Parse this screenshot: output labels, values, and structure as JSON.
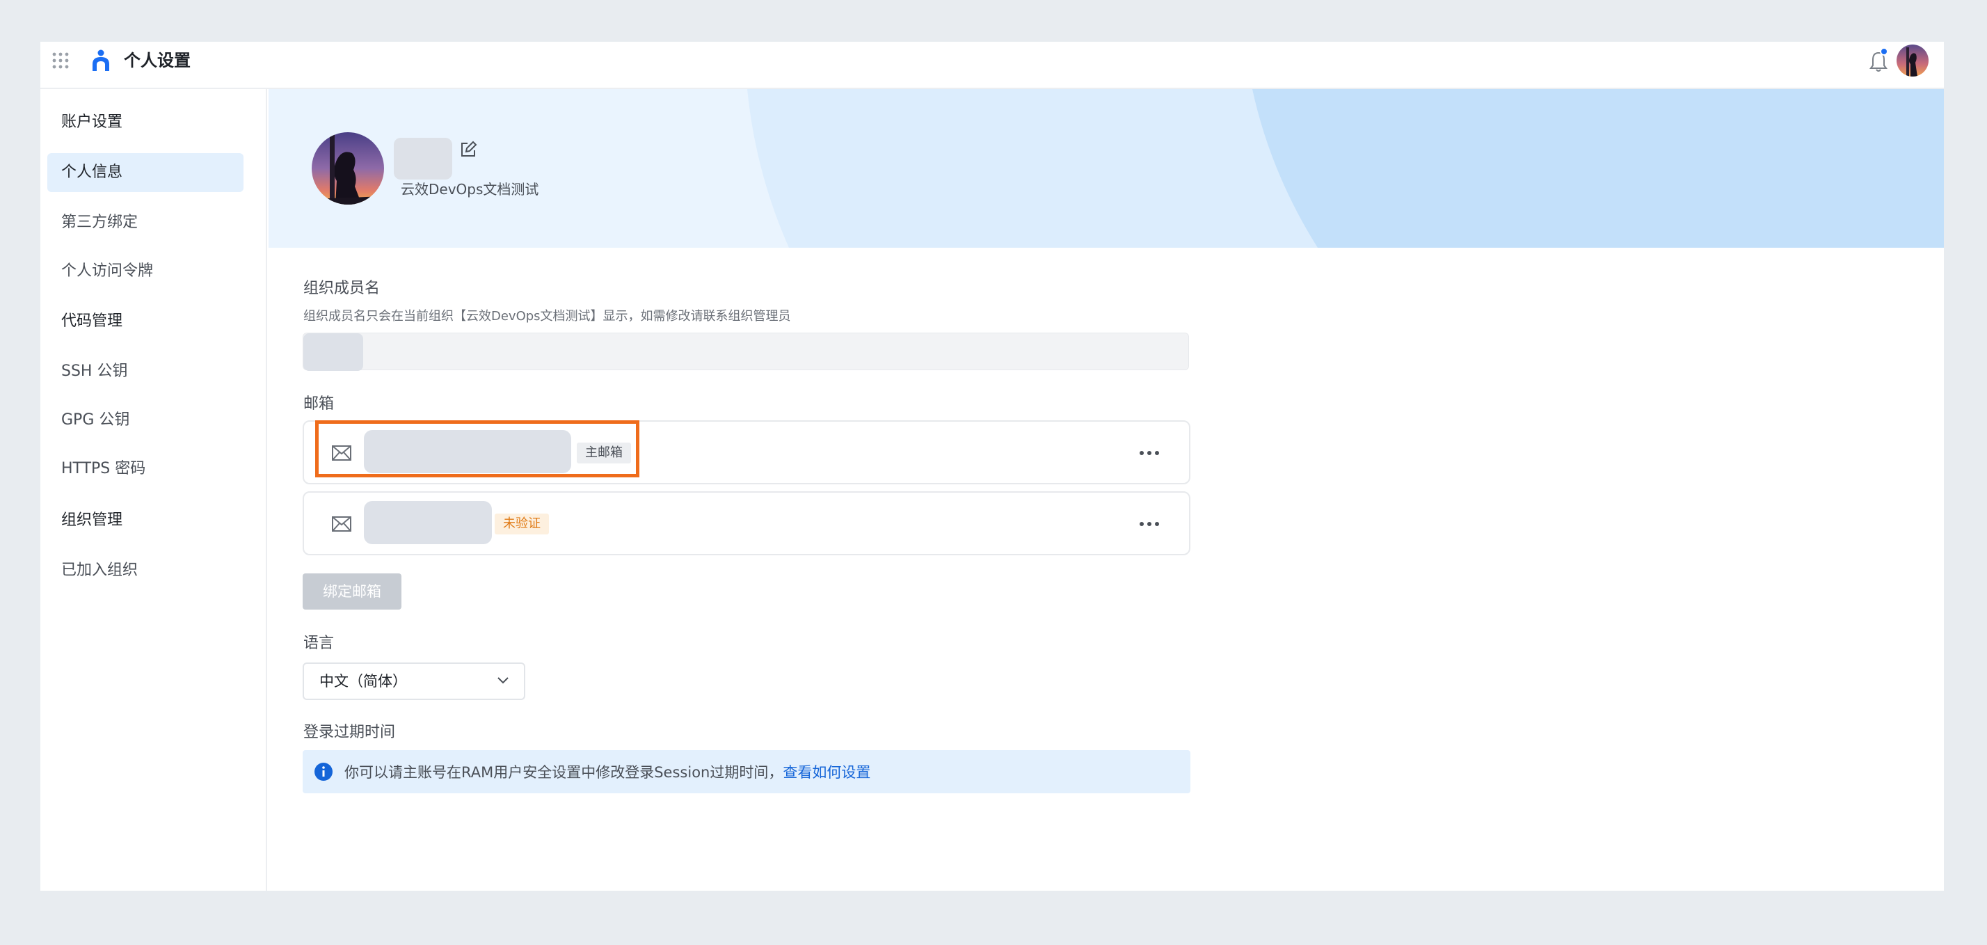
{
  "header": {
    "app_title": "个人设置",
    "icons": [
      "apps-grid-icon",
      "logo-icon",
      "bell-icon",
      "avatar"
    ]
  },
  "sidebar": {
    "items": [
      {
        "label": "账户设置",
        "type": "group"
      },
      {
        "label": "个人信息",
        "type": "item",
        "active": true
      },
      {
        "label": "第三方绑定",
        "type": "item"
      },
      {
        "label": "个人访问令牌",
        "type": "item"
      },
      {
        "label": "代码管理",
        "type": "group"
      },
      {
        "label": "SSH 公钥",
        "type": "item"
      },
      {
        "label": "GPG 公钥",
        "type": "item"
      },
      {
        "label": "HTTPS 密码",
        "type": "item"
      },
      {
        "label": "组织管理",
        "type": "group"
      },
      {
        "label": "已加入组织",
        "type": "item"
      }
    ]
  },
  "profile": {
    "org_name": "云效DevOps文档测试"
  },
  "member_name": {
    "label": "组织成员名",
    "hint": "组织成员名只会在当前组织【云效DevOps文档测试】显示，如需修改请联系组织管理员"
  },
  "email": {
    "label": "邮箱",
    "primary_badge": "主邮箱",
    "unverified_badge": "未验证",
    "bind_button": "绑定邮箱"
  },
  "language": {
    "label": "语言",
    "selected": "中文（简体）"
  },
  "login_expiry": {
    "label": "登录过期时间",
    "info_text": "你可以请主账号在RAM用户安全设置中修改登录Session过期时间，",
    "info_link": "查看如何设置"
  },
  "colors": {
    "accent": "#1b6ef3",
    "highlight": "#ef6c1b",
    "warn": "#e07b17",
    "link": "#1565d8"
  }
}
